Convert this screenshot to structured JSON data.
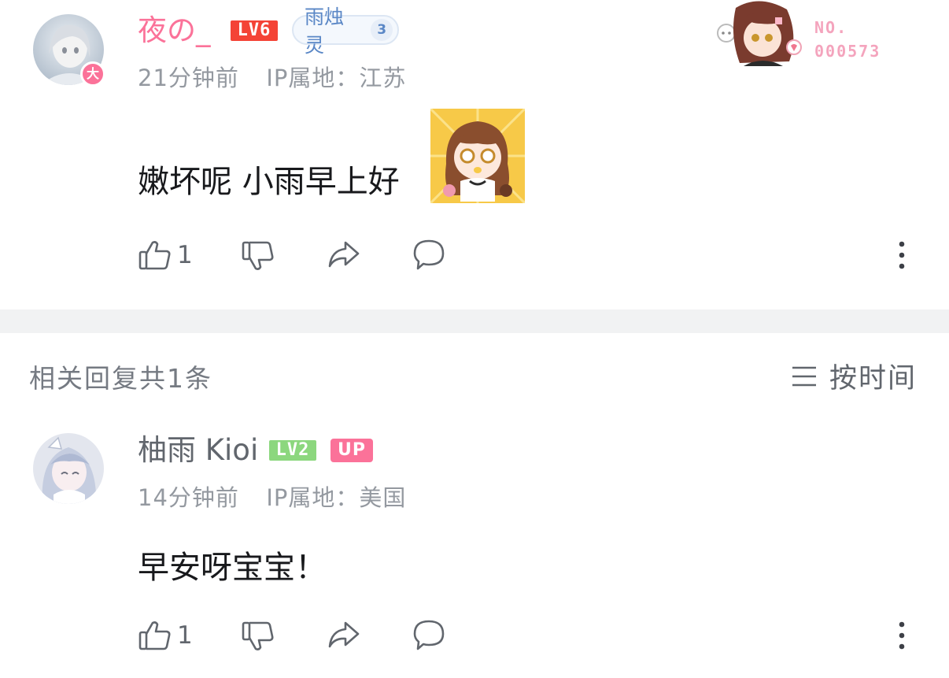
{
  "comment": {
    "username": "夜の_",
    "level_badge": "LV6",
    "fan_badge": {
      "name": "雨烛灵",
      "level": "3"
    },
    "time": "21分钟前",
    "ip_label": "IP属地：江苏",
    "text": "嫩坏呢 小雨早上好",
    "avatar_badge": "大",
    "likes": "1",
    "nft": {
      "line1": "NO.",
      "line2": "000573"
    }
  },
  "replies_header": {
    "title": "相关回复共1条",
    "sort_label": "按时间"
  },
  "reply": {
    "username": "柚雨 Kioi",
    "level_badge": "LV2",
    "up_tag": "UP",
    "time": "14分钟前",
    "ip_label": "IP属地：美国",
    "text": "早安呀宝宝！",
    "likes": "1"
  },
  "colors": {
    "pink_name": "#fb7299",
    "lv6": "#f44336",
    "lv2": "#8cd77e",
    "up": "#fb7299",
    "divider": "#f1f2f3"
  },
  "icons": [
    "thumbs-up-icon",
    "thumbs-down-icon",
    "share-icon",
    "comment-icon",
    "more-icon",
    "sort-icon"
  ]
}
